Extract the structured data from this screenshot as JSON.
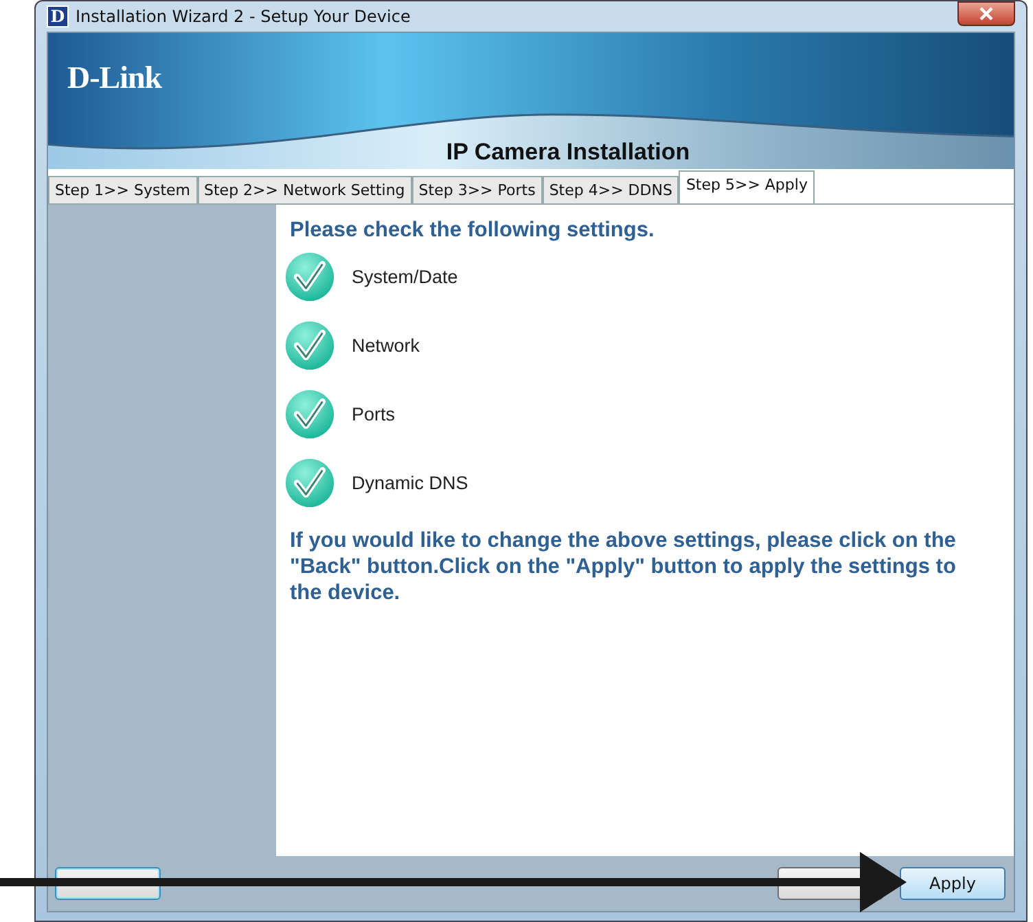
{
  "window": {
    "app_icon": "D",
    "title": "Installation Wizard 2 - Setup Your Device"
  },
  "banner": {
    "logo": "D-Link",
    "title": "IP Camera Installation"
  },
  "tabs": [
    {
      "label": "Step 1>> System",
      "selected": false
    },
    {
      "label": "Step 2>> Network Setting",
      "selected": false
    },
    {
      "label": "Step 3>> Ports",
      "selected": false
    },
    {
      "label": "Step 4>> DDNS",
      "selected": false
    },
    {
      "label": "Step 5>> Apply",
      "selected": true
    }
  ],
  "heading": "Please check the following settings.",
  "checks": [
    {
      "label": "System/Date",
      "checked": true
    },
    {
      "label": "Network",
      "checked": true
    },
    {
      "label": "Ports",
      "checked": true
    },
    {
      "label": "Dynamic DNS",
      "checked": true
    }
  ],
  "note": "If you would like to change the above settings, please click on the \"Back\" button.Click on the \"Apply\" button to apply the settings to the device.",
  "buttons": [
    {
      "kind": "cancel"
    },
    {
      "kind": "back"
    },
    {
      "label": "Apply",
      "kind": "apply"
    }
  ]
}
